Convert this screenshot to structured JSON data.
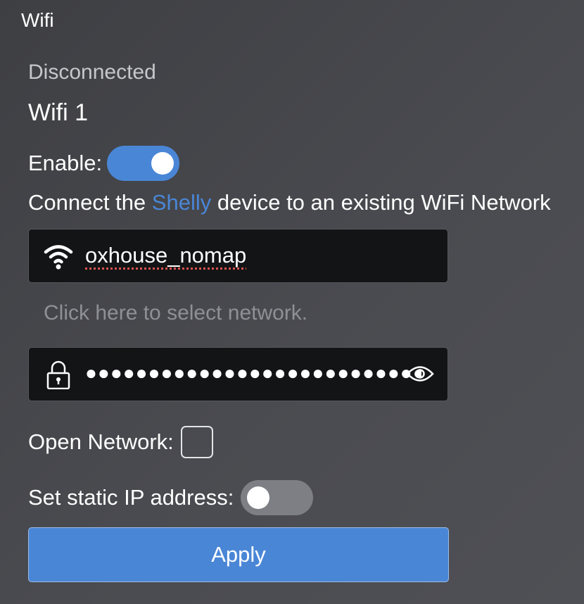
{
  "panel": {
    "title": "Wifi"
  },
  "status": "Disconnected",
  "wifi": {
    "name": "Wifi 1",
    "enable_label": "Enable:",
    "enabled": true,
    "description_before": "Connect the ",
    "description_brand": "Shelly",
    "description_after": " device to an existing WiFi Network",
    "ssid_icon": "wifi-icon",
    "ssid": "oxhouse_nomap",
    "select_hint": "Click here to select network.",
    "password_icon": "lock-icon",
    "password_masked": "●●●●●●●●●●●●●●●●●●●●●●●●●●●●●●●●●",
    "show_password_icon": "eye-icon",
    "open_network_label": "Open Network:",
    "open_network_checked": false,
    "static_ip_label": "Set static IP address:",
    "static_ip_enabled": false,
    "apply_label": "Apply"
  },
  "colors": {
    "accent": "#4a86d6",
    "field_background": "#131416",
    "hint_text": "#8e9095",
    "toggle_off": "#7d7f84"
  }
}
